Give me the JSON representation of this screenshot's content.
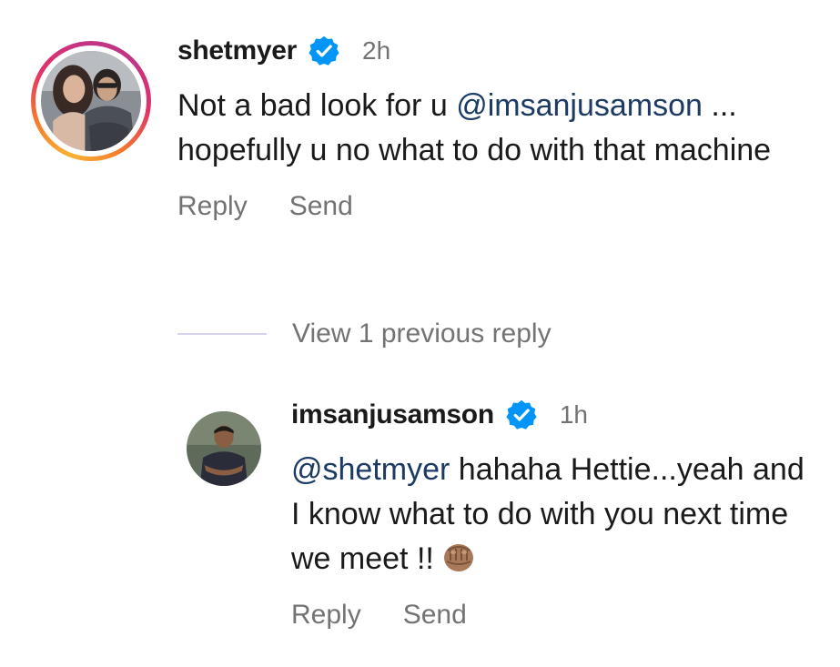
{
  "comments": [
    {
      "username": "shetmyer",
      "verified": true,
      "time": "2h",
      "text_before": "Not a bad look for u ",
      "mention": "@imsanjusamson",
      "text_after": " ... hopefully u no what to do with that machine",
      "reply_label": "Reply",
      "send_label": "Send",
      "avatar_icon": "profile-photo-couple",
      "avatar_ring": true
    }
  ],
  "view_replies_label": "View 1 previous reply",
  "replies": [
    {
      "username": "imsanjusamson",
      "verified": true,
      "time": "1h",
      "mention": "@shetmyer",
      "text_after": " hahaha Hettie...yeah and I know what to do with you next time we meet !!",
      "emoji": "fist-emoji",
      "reply_label": "Reply",
      "send_label": "Send",
      "avatar_icon": "profile-photo-man"
    }
  ],
  "colors": {
    "verified_blue": "#0095f6",
    "mention": "#1c3a63",
    "muted": "#737373"
  }
}
